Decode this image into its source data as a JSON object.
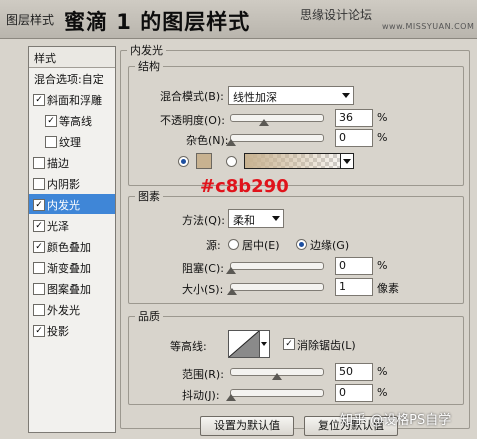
{
  "window": {
    "title_small": "图层样式",
    "title_big": "蜜滴 1 的图层样式",
    "watermark": "思缘设计论坛",
    "watermark_url": "www.MISSYUAN.COM"
  },
  "sidebar": {
    "header": "样式",
    "blend_options": "混合选项:自定",
    "items": [
      {
        "label": "斜面和浮雕",
        "checked": true
      },
      {
        "label": "等高线",
        "checked": true,
        "indent": true
      },
      {
        "label": "纹理",
        "checked": false,
        "indent": true
      },
      {
        "label": "描边",
        "checked": false
      },
      {
        "label": "内阴影",
        "checked": false
      },
      {
        "label": "内发光",
        "checked": true,
        "selected": true
      },
      {
        "label": "光泽",
        "checked": true
      },
      {
        "label": "颜色叠加",
        "checked": true
      },
      {
        "label": "渐变叠加",
        "checked": false
      },
      {
        "label": "图案叠加",
        "checked": false
      },
      {
        "label": "外发光",
        "checked": false
      },
      {
        "label": "投影",
        "checked": true
      }
    ]
  },
  "inner_glow": {
    "title": "内发光",
    "structure": {
      "title": "结构",
      "blend_mode_label": "混合模式(B):",
      "blend_mode_value": "线性加深",
      "opacity_label": "不透明度(O):",
      "opacity_value": "36",
      "opacity_fraction": 0.36,
      "noise_label": "杂色(N):",
      "noise_value": "0",
      "percent": "%",
      "color": "#c8b290",
      "annotation": "#c8b290"
    },
    "elements": {
      "title": "图素",
      "method_label": "方法(Q):",
      "method_value": "柔和",
      "source_label": "源:",
      "source_center": "居中(E)",
      "source_edge": "边缘(G)",
      "choke_label": "阻塞(C):",
      "choke_value": "0",
      "size_label": "大小(S):",
      "size_value": "1",
      "size_unit": "像素"
    },
    "quality": {
      "title": "品质",
      "contour_label": "等高线:",
      "antialias_label": "消除锯齿(L)",
      "range_label": "范围(R):",
      "range_value": "50",
      "range_fraction": 0.5,
      "jitter_label": "抖动(J):",
      "jitter_value": "0",
      "percent": "%"
    },
    "buttons": {
      "set_default": "设置为默认值",
      "reset_default": "复位为默认值"
    }
  },
  "footer_watermark": "知乎 @设格PS自学"
}
